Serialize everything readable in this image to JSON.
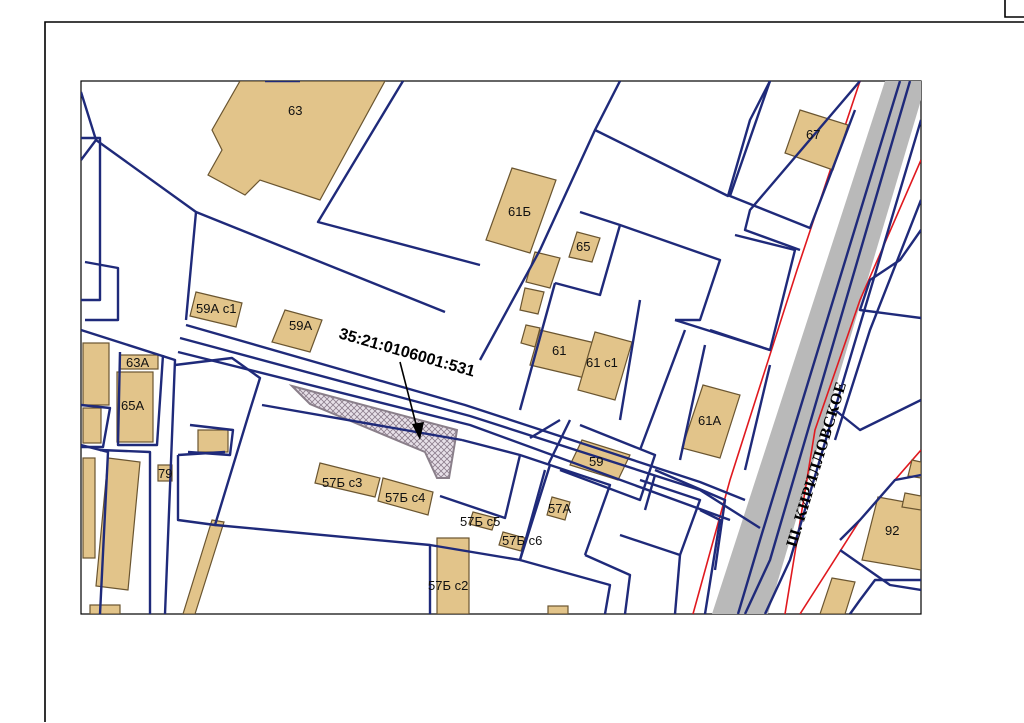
{
  "map": {
    "cadastral_number": "35:21:0106001:531",
    "street_name": "Ш. КИРИЛЛОВСКОЕ",
    "labels": {
      "b63": "63",
      "b67": "67",
      "b61b": "61Б",
      "b65": "65",
      "b61": "61",
      "b61c1": "61 с1",
      "b59ac1": "59А с1",
      "b59a": "59А",
      "b63a": "63А",
      "b65a": "65А",
      "b79": "79",
      "b61a": "61А",
      "b59": "59",
      "b57bc3": "57Б с3",
      "b57bc4": "57Б с4",
      "b57bc5": "57Б с5",
      "b57bc6": "57Б с6",
      "b57a": "57А",
      "b57bc2": "57Б с2",
      "b92": "92"
    },
    "colors": {
      "building": "#e2c48a",
      "parcel_boundary": "#1f2a7a",
      "red_line": "#e0191f",
      "road": "#b9b9b9",
      "highlighted_parcel": "#d8d0d8"
    }
  }
}
